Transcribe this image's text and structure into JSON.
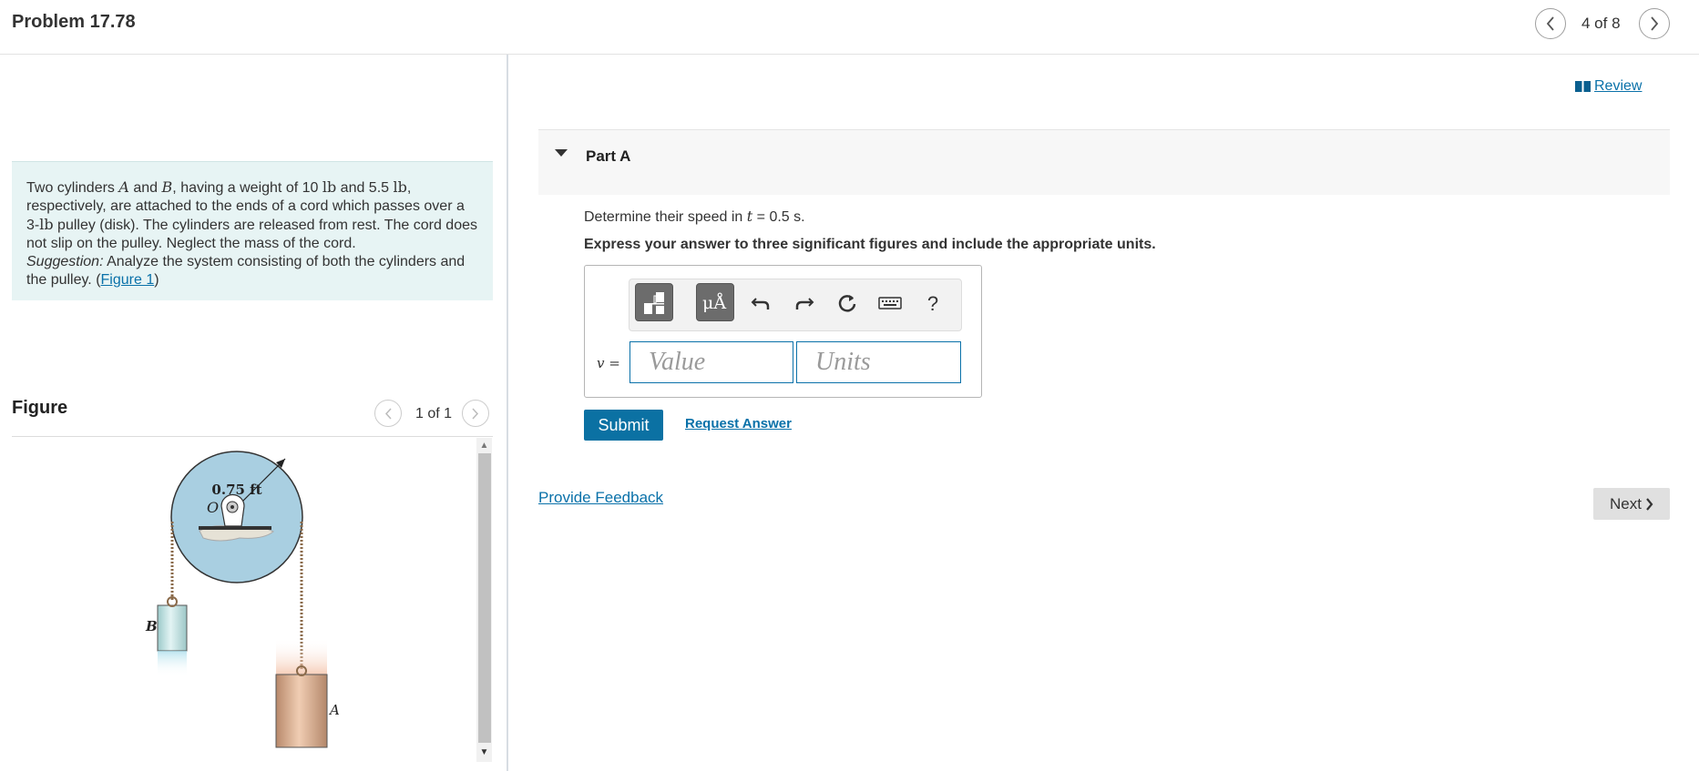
{
  "header": {
    "title": "Problem 17.78",
    "page_count": "4 of 8"
  },
  "problem": {
    "text_1": "Two cylinders ",
    "var_a": "A",
    "text_2": " and ",
    "var_b": "B",
    "text_3": ", having a weight of 10 ",
    "unit_lb_1": "lb",
    "text_4": " and 5.5 ",
    "unit_lb_2": "lb",
    "text_5": ", respectively, are attached to the ends of a cord which passes over a 3-",
    "unit_lb_3": "lb",
    "text_6": " pulley (disk). The cylinders are released from rest. The cord does not slip on the pulley. Neglect the mass of the cord.",
    "suggestion_label": "Suggestion:",
    "suggestion_text": " Analyze the system consisting of both the cylinders and the pulley. (",
    "figure_link": "Figure 1",
    "close_paren": ")"
  },
  "figure": {
    "label": "Figure",
    "count": "1 of 1",
    "radius_label": "0.75 ft",
    "point_o": "O",
    "point_a": "A",
    "point_b": "B"
  },
  "right": {
    "review_label": "Review",
    "part_label": "Part A",
    "determine_text": "Determine their speed in ",
    "t_var": "t",
    "t_value": " = 0.5 s.",
    "express_text": "Express your answer to three significant figures and include the appropriate units.",
    "v_label": "v",
    "equals": " =",
    "value_placeholder": "Value",
    "units_placeholder": "Units",
    "submit_label": "Submit",
    "request_answer_label": "Request Answer",
    "provide_feedback_label": "Provide Feedback",
    "next_label": "Next",
    "help_label": "?",
    "mu_label": "μÅ"
  }
}
